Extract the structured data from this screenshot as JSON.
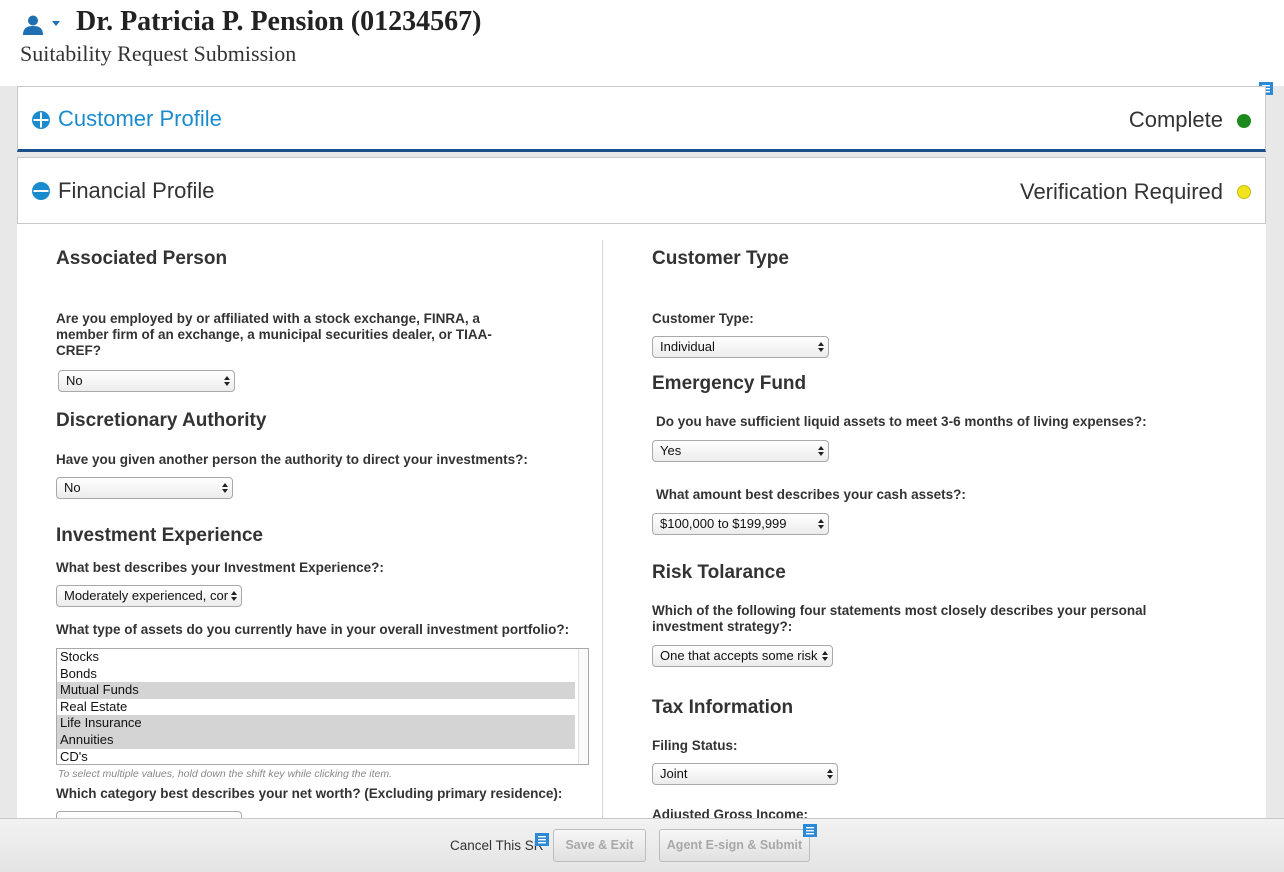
{
  "header": {
    "name": "Dr. Patricia P. Pension (01234567)",
    "subtitle": "Suitability Request Submission"
  },
  "sections": {
    "customer_profile": {
      "title": "Customer Profile",
      "status": "Complete",
      "status_color": "#1e8a1e",
      "title_color": "#1a8ccd"
    },
    "financial_profile": {
      "title": "Financial Profile",
      "status": "Verification Required",
      "status_color": "#f2e41c",
      "title_color": "#333333"
    }
  },
  "left": {
    "associated_person": {
      "heading": "Associated Person",
      "question": "Are you employed by or affiliated with a stock exchange, FINRA, a member firm of an exchange, a municipal securities dealer, or TIAA-CREF?",
      "value": "No"
    },
    "discretionary_authority": {
      "heading": "Discretionary Authority",
      "question": "Have you given another person the authority to direct your investments?:",
      "value": "No"
    },
    "investment_experience": {
      "heading": "Investment Experience",
      "question": "What best describes your Investment Experience?:",
      "value": "Moderately experienced, cor",
      "assets_question": "What type of assets do you currently have in your overall investment portfolio?:",
      "assets": [
        {
          "label": "Stocks",
          "selected": false
        },
        {
          "label": "Bonds",
          "selected": false
        },
        {
          "label": "Mutual Funds",
          "selected": true
        },
        {
          "label": "Real Estate",
          "selected": false
        },
        {
          "label": "Life Insurance",
          "selected": true
        },
        {
          "label": "Annuities",
          "selected": true
        },
        {
          "label": "CD's",
          "selected": false
        }
      ],
      "hint": "To select multiple values, hold down the shift key while clicking the item.",
      "net_worth_question": "Which category best describes your net worth? (Excluding primary residence):"
    }
  },
  "right": {
    "customer_type": {
      "heading": "Customer Type",
      "label": "Customer Type:",
      "value": "Individual"
    },
    "emergency_fund": {
      "heading": "Emergency Fund",
      "question": "Do you have sufficient liquid assets to meet 3-6 months of living expenses?:",
      "value": "Yes",
      "cash_question": "What amount best describes your cash assets?:",
      "cash_value": "$100,000 to $199,999"
    },
    "risk_tolerance": {
      "heading": "Risk Tolarance",
      "question": "Which of the following four statements most closely describes your personal investment strategy?:",
      "value": "One that accepts some risk"
    },
    "tax_information": {
      "heading": "Tax Information",
      "filing_label": "Filing Status:",
      "filing_value": "Joint",
      "agi_label": "Adjusted Gross Income:"
    }
  },
  "footer": {
    "cancel": "Cancel This SR",
    "save_exit": "Save & Exit",
    "agent_submit": "Agent E-sign & Submit"
  },
  "icons": {
    "user": "user-icon",
    "section_customer": "expand-plus-icon",
    "section_financial": "collapse-minus-icon",
    "note": "note-icon"
  }
}
